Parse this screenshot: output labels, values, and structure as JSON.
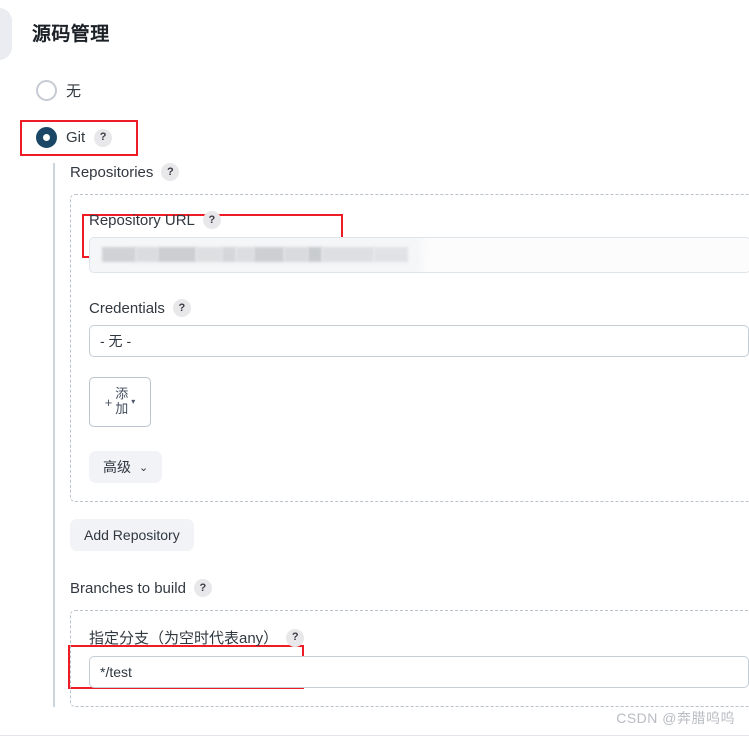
{
  "page": {
    "title": "源码管理"
  },
  "scm": {
    "options": [
      {
        "label": "无",
        "selected": false,
        "has_help": false
      },
      {
        "label": "Git",
        "selected": true,
        "has_help": true
      }
    ]
  },
  "git": {
    "repositories_label": "Repositories",
    "repository_url_label": "Repository URL",
    "repository_url_value": "",
    "credentials_label": "Credentials",
    "credentials_value": "- 无 -",
    "add_button": {
      "plus": "+",
      "line1": "添",
      "line2": "加",
      "caret": "▾"
    },
    "advanced_button": {
      "label": "高级",
      "chevron": "⌄"
    },
    "add_repository_button": "Add Repository",
    "branches_label": "Branches to build",
    "branch_specifier_label": "指定分支（为空时代表any）",
    "branch_specifier_value": "*/test",
    "help_glyph": "?"
  },
  "annotations": {
    "accent_color": "#ee1c25",
    "boxes": [
      "git-option",
      "repository-url-label",
      "branch-specifier-label"
    ]
  },
  "watermark": {
    "text": "CSDN @奔腊呜呜"
  }
}
